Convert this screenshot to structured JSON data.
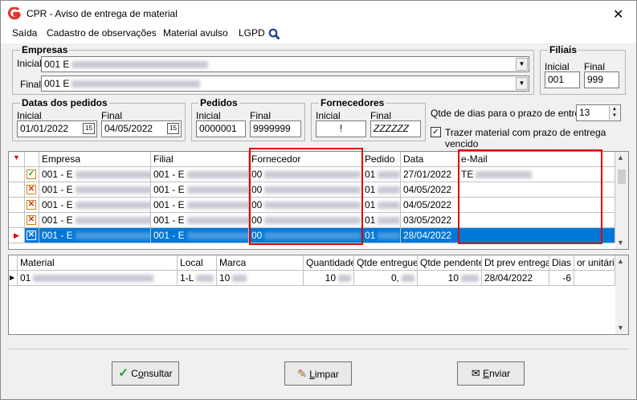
{
  "window": {
    "title": "CPR - Aviso de entrega de material",
    "close": "✕"
  },
  "menu": [
    {
      "label": "Saída"
    },
    {
      "label": "Cadastro de observações"
    },
    {
      "label": "Material avulso"
    },
    {
      "label": "LGPD"
    }
  ],
  "empresas": {
    "title": "Empresas",
    "inicial_label": "Inicial",
    "inicial_value": "001 E",
    "final_label": "Final",
    "final_value": "001 E"
  },
  "filiais": {
    "title": "Filiais",
    "inicial_label": "Inicial",
    "final_label": "Final",
    "inicial_value": "001",
    "final_value": "999"
  },
  "datas": {
    "title": "Datas dos pedidos",
    "inicial_label": "Inicial",
    "final_label": "Final",
    "inicial_value": "01/01/2022",
    "final_value": "04/05/2022",
    "cal_glyph": "15"
  },
  "pedidos": {
    "title": "Pedidos",
    "inicial_label": "Inicial",
    "final_label": "Final",
    "inicial_value": "0000001",
    "final_value": "9999999"
  },
  "fornecedores": {
    "title": "Fornecedores",
    "inicial_label": "Inicial",
    "final_label": "Final",
    "inicial_value": "!",
    "final_value": "ZZZZZZ"
  },
  "qtde": {
    "label": "Qtde de dias para o prazo de entrega",
    "value": "13"
  },
  "trazer": {
    "label": "Trazer material com prazo de entrega vencido",
    "checked": true
  },
  "grid1": {
    "headers": [
      "Empresa",
      "Filial",
      "Fornecedor",
      "Pedido",
      "Data",
      "e-Mail"
    ],
    "rows": [
      {
        "empresa": "001 - E",
        "filial": "001 - E",
        "fornecedor": "00",
        "pedido": "01",
        "data": "27/01/2022",
        "email": "TE",
        "mark": "check",
        "selected": false
      },
      {
        "empresa": "001 - E",
        "filial": "001 - E",
        "fornecedor": "00",
        "pedido": "01",
        "data": "04/05/2022",
        "email": "",
        "mark": "x",
        "selected": false
      },
      {
        "empresa": "001 - E",
        "filial": "001 - E",
        "fornecedor": "00",
        "pedido": "01",
        "data": "04/05/2022",
        "email": "",
        "mark": "x",
        "selected": false
      },
      {
        "empresa": "001 - E",
        "filial": "001 - E",
        "fornecedor": "00",
        "pedido": "01",
        "data": "03/05/2022",
        "email": "",
        "mark": "x",
        "selected": false
      },
      {
        "empresa": "001 - E",
        "filial": "001 - E",
        "fornecedor": "00",
        "pedido": "01",
        "data": "28/04/2022",
        "email": "",
        "mark": "x",
        "selected": true
      }
    ]
  },
  "grid2": {
    "headers": [
      "Material",
      "Local",
      "Marca",
      "Quantidade",
      "Qtde entregue",
      "Qtde pendente",
      "Dt prev entrega",
      "Dias",
      "or unitário"
    ],
    "row": {
      "material": "01",
      "local": "1-L",
      "marca": "10",
      "quantidade": "10",
      "entregue": "0,",
      "pendente": "10",
      "dt_prev": "28/04/2022",
      "dias": "-6",
      "valor": ""
    }
  },
  "buttons": {
    "consultar_pre": "C",
    "consultar_u": "o",
    "consultar_post": "nsultar",
    "limpar_u": "L",
    "limpar_post": "impar",
    "enviar_u": "E",
    "enviar_post": "nviar"
  },
  "colors": {
    "selection": "#0078d7",
    "highlight": "#e00000",
    "logo": "#e0352b"
  }
}
